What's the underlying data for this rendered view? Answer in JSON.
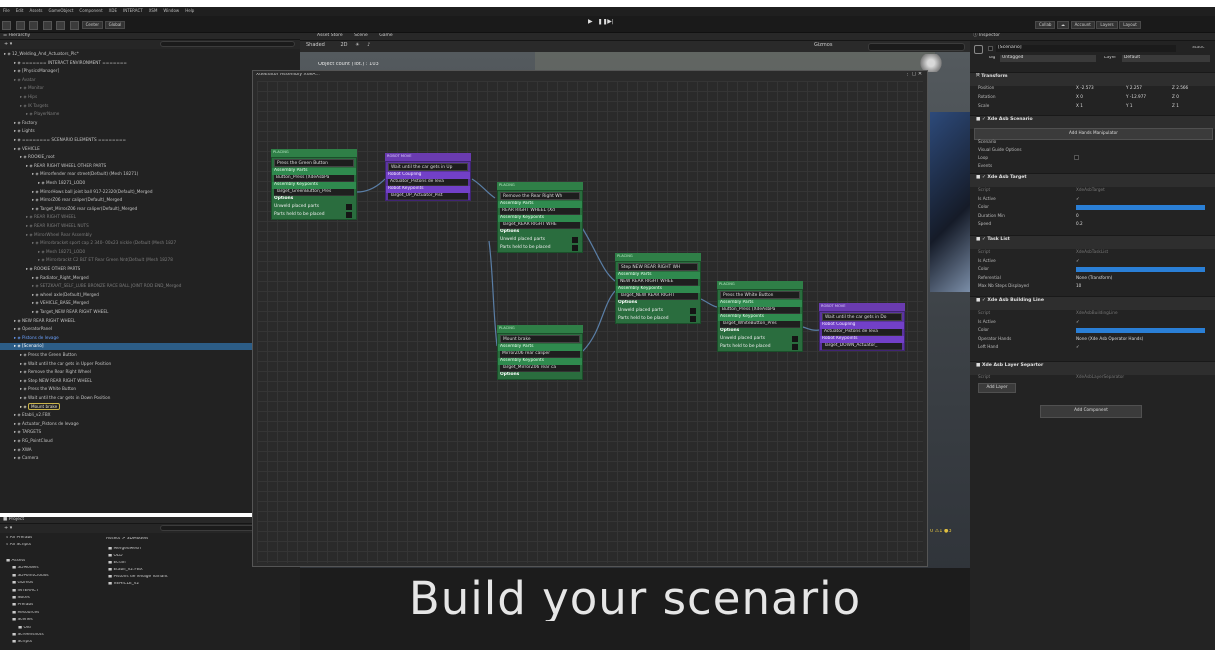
{
  "menu": [
    "File",
    "Edit",
    "Assets",
    "GameObject",
    "Component",
    "XDE",
    "INTERACT",
    "XSM",
    "Window",
    "Help"
  ],
  "toolbar": {
    "center": "Center",
    "global": "Global",
    "collab": "Collab",
    "account": "Account",
    "layers": "Layers",
    "layout": "Layout"
  },
  "hierarchy": {
    "title": "Hierarchy",
    "rows": [
      {
        "t": "12_Welding_And_Actuators_Plc*",
        "c": ""
      },
      {
        "t": "======= INTERACT ENVIRONMENT =======",
        "c": ""
      },
      {
        "t": "[PhysicsManager]",
        "c": ""
      },
      {
        "t": "Avatar",
        "c": "dim"
      },
      {
        "t": "Monitor",
        "c": "dim"
      },
      {
        "t": "Hips",
        "c": "dim"
      },
      {
        "t": "IK Targets",
        "c": "dim"
      },
      {
        "t": "PlayerName",
        "c": "dim"
      },
      {
        "t": "Factory",
        "c": ""
      },
      {
        "t": "Lights",
        "c": ""
      },
      {
        "t": "======== SCENARIO ELEMENTS ========",
        "c": ""
      },
      {
        "t": "VEHICLE",
        "c": ""
      },
      {
        "t": "ROOKIE_root",
        "c": ""
      },
      {
        "t": "REAR RIGHT WHEEL OTHER PARTS",
        "c": ""
      },
      {
        "t": "Mirrorfender rear street(Default) (Mesh 18271)",
        "c": ""
      },
      {
        "t": "Mesh 18271_LOD0",
        "c": ""
      },
      {
        "t": "MirrorHows ball joint ball 917-22320(Default)_Merged",
        "c": ""
      },
      {
        "t": "MirrorZ06 rear caliper(Default)_Merged",
        "c": ""
      },
      {
        "t": "Target_MirrorZ06 rear caliper(Default)_Merged",
        "c": ""
      },
      {
        "t": "REAR RIGHT WHEEL",
        "c": "dim"
      },
      {
        "t": "REAR RIGHT WHEEL NUTS",
        "c": "dim"
      },
      {
        "t": "MirrorWheel Rear Assembly",
        "c": "dim"
      },
      {
        "t": "Mirrorbracket sport cap 2 340- 00x23 nickle (Default (Mesh 1827",
        "c": "dim"
      },
      {
        "t": "Mesh 18271_LOD0",
        "c": "dim"
      },
      {
        "t": "Mirrorbrackt C2 BLT ET Rear Green Nnt(Default (Mesh 18278",
        "c": "dim"
      },
      {
        "t": "ROOKIE OTHER PARTS",
        "c": ""
      },
      {
        "t": "Radiator_Right_Merged",
        "c": ""
      },
      {
        "t": "SETZKAAT_SELF_LUBE BRONZE RACE BALL JOINT ROD END_Merged",
        "c": "dim"
      },
      {
        "t": "wheel axle(Default)_Merged",
        "c": ""
      },
      {
        "t": "VEHICLE_BASE_Merged",
        "c": ""
      },
      {
        "t": "Target_NEW REAR RIGHT WHEEL",
        "c": ""
      },
      {
        "t": "NEW REAR RIGHT WHEEL",
        "c": ""
      },
      {
        "t": "OperatorPanel",
        "c": ""
      },
      {
        "t": "Pistons de levage",
        "c": "sel"
      },
      {
        "t": "[Scenario]",
        "c": "hl"
      },
      {
        "t": "Press the Green Button",
        "c": ""
      },
      {
        "t": "Wait until the car gets in Upper Position",
        "c": ""
      },
      {
        "t": "Remove the Rear Right Wheel",
        "c": ""
      },
      {
        "t": "Step NEW REAR RIGHT WHEEL",
        "c": ""
      },
      {
        "t": "Press the White Button",
        "c": ""
      },
      {
        "t": "Wait until the car gets in Down Position",
        "c": ""
      },
      {
        "t": "Mount brake",
        "c": "boxed"
      },
      {
        "t": "Etabli_v2.FBX",
        "c": ""
      },
      {
        "t": "Actuator_Pistons de levage",
        "c": ""
      },
      {
        "t": "TARGETS",
        "c": ""
      },
      {
        "t": "RG_PointCloud",
        "c": ""
      },
      {
        "t": "XWA",
        "c": ""
      },
      {
        "t": "Camera",
        "c": ""
      }
    ]
  },
  "project": {
    "title": "Project",
    "favorites": [
      "All Prefabs",
      "All Scripts"
    ],
    "tree": [
      "Assets",
      "3DModels",
      "3DPointClouds",
      "Gizmos",
      "INTERACT",
      "Notes",
      "Prefabs",
      "Resources",
      "Scenes",
      "Old",
      "Screenshots",
      "Scripts"
    ],
    "breadcrumb": "Assets > 3DModels",
    "files": [
      "MergedMesh",
      "OLD",
      "Ecran",
      "Etabli_v2.FBX",
      "Pistons de levage Variant",
      "VEHICLE_v2"
    ]
  },
  "scene_tabs": [
    "Asset Store",
    "Scene",
    "Game"
  ],
  "scene_shading": "Shaded",
  "scene_gizmos": "Gizmos",
  "scene_mode": "2D",
  "object_count": "Object count (Tot.) : 103",
  "editor": {
    "title": "XdeEditor Assembly XdeA...",
    "nodes": {
      "n1": {
        "head": "PLACING",
        "name": "Press the Green Button",
        "sec1": "Assembly Parts",
        "item1": "Button_Press (XdeAsbPa",
        "sec2": "Assembly Keypoints",
        "item2": "Target_GreenButton_Pres",
        "opt": "Options",
        "c1": "Unweld placed parts",
        "c2": "Parts held to be placed"
      },
      "n2": {
        "head": "ROBOT MOVE",
        "name": "Wait until the car gets in Up",
        "sec1": "Robot Coupling",
        "item1": "Actuator_Pistons de leva",
        "sec2": "Robot Keypoints",
        "item2": "Target_UP_Actuator_Pist"
      },
      "n3": {
        "head": "PLACING",
        "name": "Remove the Rear Right Wh",
        "sec1": "Assembly Parts",
        "item1": "REAR RIGHT WHEEL (Xd",
        "sec2": "Assembly Keypoints",
        "item2": "Target_REAR RIGHT WHE",
        "opt": "Options",
        "c1": "Unweld placed parts",
        "c2": "Parts held to be placed"
      },
      "n4": {
        "head": "PLACING",
        "name": "Step NEW REAR RIGHT WH",
        "sec1": "Assembly Parts",
        "item1": "NEW REAR RIGHT WHEE",
        "sec2": "Assembly Keypoints",
        "item2": "Target_NEW REAR RIGHT",
        "opt": "Options",
        "c1": "Unweld placed parts",
        "c2": "Parts held to be placed"
      },
      "n5": {
        "head": "PLACING",
        "name": "Press the White Button",
        "sec1": "Assembly Parts",
        "item1": "Button_Press (XdeAsbPa",
        "sec2": "Assembly Keypoints",
        "item2": "Target_WhiteButton_Pres",
        "opt": "Options",
        "c1": "Unweld placed parts",
        "c2": "Parts held to be placed"
      },
      "n6": {
        "head": "ROBOT MOVE",
        "name": "Wait until the car gets in Do",
        "sec1": "Robot Coupling",
        "item1": "Actuator_Pistons de leva",
        "sec2": "Robot Keypoints",
        "item2": "Target_DOWN_Actuator_"
      },
      "n7": {
        "head": "PLACING",
        "name": "Mount brake",
        "sec1": "Assembly Parts",
        "item1": "MirrorZ06 rear caliper",
        "sec2": "Assembly Keypoints",
        "item2": "Target_MirrorZ06 rear ca",
        "opt": "Options"
      }
    }
  },
  "inspector": {
    "title": "Inspector",
    "object_name": "[Scenario]",
    "static": "Static",
    "tag_label": "Tag",
    "tag": "Untagged",
    "layer_label": "Layer",
    "layer": "Default",
    "transform": {
      "title": "Transform",
      "position": [
        "Position",
        "X -2.573",
        "Y 2.257",
        "Z 2.566"
      ],
      "rotation": [
        "Rotation",
        "X 0",
        "Y -12.977",
        "Z 0"
      ],
      "scale": [
        "Scale",
        "X 1",
        "Y 1",
        "Z 1"
      ]
    },
    "scenario": {
      "title": "Xde Asb Scenario",
      "button": "Add Hands Manipulator",
      "rows": [
        "Scenario",
        "Visual Guide Options",
        "Loop",
        "Events"
      ]
    },
    "target": {
      "title": "Xde Asb Target",
      "rows": [
        [
          "Script",
          "XdeAsbTarget"
        ],
        [
          "Is Active",
          "✓"
        ],
        [
          "Color",
          ""
        ],
        [
          "Duration Min",
          "0"
        ],
        [
          "Speed",
          "0.2"
        ]
      ]
    },
    "tasklist": {
      "title": "Task List",
      "rows": [
        [
          "Script",
          "XdeAsbTaskList"
        ],
        [
          "Is Active",
          "✓"
        ],
        [
          "Color",
          ""
        ],
        [
          "Referential",
          "None (Transform)"
        ],
        [
          "Max Nb Steps Displayed",
          "10"
        ]
      ]
    },
    "building": {
      "title": "Xde Asb Building Line",
      "rows": [
        [
          "Script",
          "XdeAsbBuildingLine"
        ],
        [
          "Is Active",
          "✓"
        ],
        [
          "Color",
          ""
        ],
        [
          "Operator Hands",
          "None (Xde Asb Operator Hands)"
        ],
        [
          "Left Hand",
          "✓"
        ]
      ]
    },
    "layer_sep": {
      "title": "Xde Asb Layer Separtor",
      "rows": [
        [
          "Script",
          "XdeAsbLayerSeparator"
        ]
      ],
      "button": "Add Layer"
    },
    "add_component": "Add Component"
  },
  "game_status": "0  ⚠1  ●3",
  "caption": "Build your scenario",
  "colors": {
    "placing": "#2f7f47",
    "robot": "#6a3bb0",
    "selection": "#2c5d87",
    "accent": "#2a7fd6"
  }
}
